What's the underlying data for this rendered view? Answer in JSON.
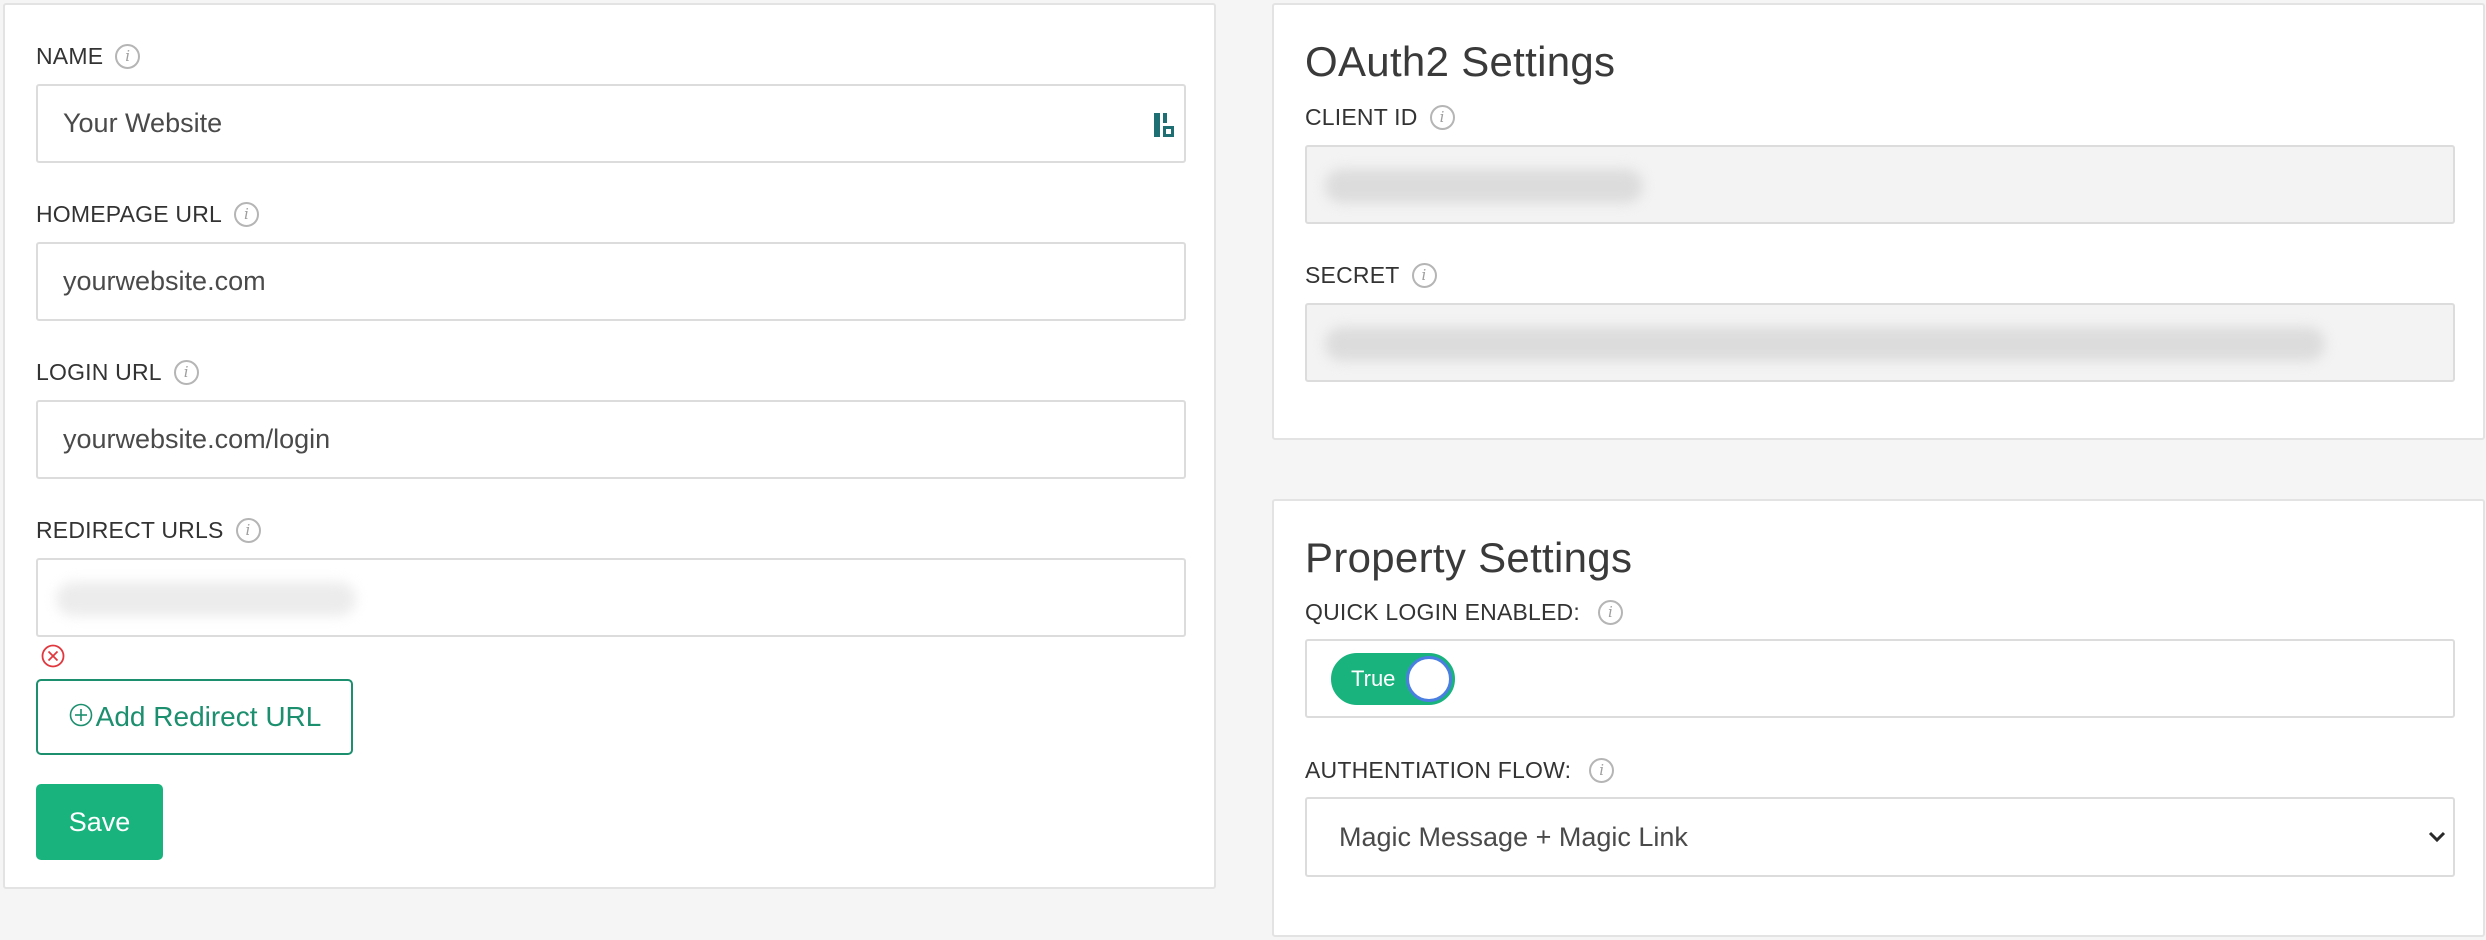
{
  "left_panel": {
    "name": {
      "label": "NAME",
      "value": "Your Website",
      "trailing_icon": "password-manager-icon"
    },
    "homepage_url": {
      "label": "HOMEPAGE URL",
      "value": "yourwebsite.com"
    },
    "login_url": {
      "label": "LOGIN URL",
      "value": "yourwebsite.com/login"
    },
    "redirect_urls": {
      "label": "REDIRECT URLS",
      "remove_icon": "remove-circle-icon"
    },
    "add_redirect_label": "Add Redirect URL",
    "add_icon": "plus-circle-icon",
    "save_label": "Save"
  },
  "oauth_panel": {
    "title": "OAuth2 Settings",
    "client_id": {
      "label": "CLIENT ID"
    },
    "secret": {
      "label": "SECRET"
    }
  },
  "property_panel": {
    "title": "Property Settings",
    "quick_login": {
      "label": "QUICK LOGIN ENABLED:",
      "toggle_label": "True",
      "enabled": true
    },
    "auth_flow": {
      "label": "AUTHENTIATION FLOW:",
      "selected": "Magic Message + Magic Link"
    }
  },
  "info_icon_glyph": "i",
  "colors": {
    "accent": "#19b37e",
    "accent_dark": "#1c8f6e",
    "danger": "#e0383e",
    "background": "#f5f5f5"
  }
}
